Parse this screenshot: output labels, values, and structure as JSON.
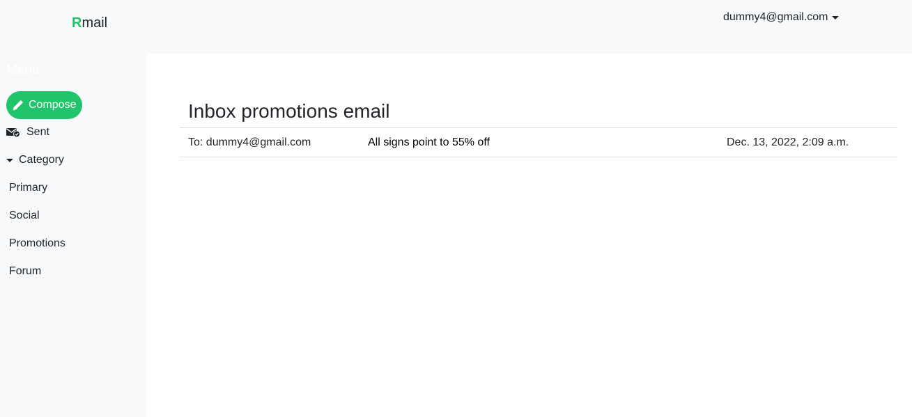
{
  "brand": {
    "first_letter": "R",
    "rest": "mail"
  },
  "account": {
    "email": "dummy4@gmail.com"
  },
  "sidebar": {
    "menu_title": "Menu",
    "compose_label": "Compose",
    "sent_label": "Sent",
    "category_label": "Category",
    "categories": [
      "Primary",
      "Social",
      "Promotions",
      "Forum"
    ]
  },
  "main": {
    "title": "Inbox promotions email",
    "emails": [
      {
        "to": "To: dummy4@gmail.com",
        "subject": "All signs point to 55% off",
        "date": "Dec. 13, 2022, 2:09 a.m."
      }
    ]
  },
  "colors": {
    "accent": "#20c46a",
    "panel_bg": "#f8f9fa"
  }
}
